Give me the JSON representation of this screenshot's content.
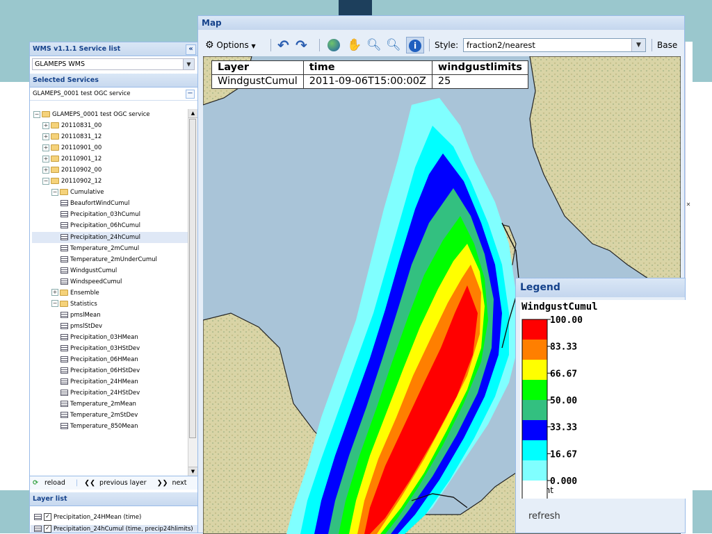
{
  "left_panel": {
    "wms_header": "WMS v1.1.1 Service list",
    "wms_combo_value": "GLAMEPS WMS",
    "selected_header": "Selected Services",
    "service_title": "GLAMEPS_0001 test OGC service",
    "tree": [
      {
        "label": "GLAMEPS_0001 test OGC service",
        "type": "folder",
        "level": 0,
        "expanded": true
      },
      {
        "label": "20110831_00",
        "type": "folder",
        "level": 1,
        "expanded": false
      },
      {
        "label": "20110831_12",
        "type": "folder",
        "level": 1,
        "expanded": false
      },
      {
        "label": "20110901_00",
        "type": "folder",
        "level": 1,
        "expanded": false
      },
      {
        "label": "20110901_12",
        "type": "folder",
        "level": 1,
        "expanded": false
      },
      {
        "label": "20110902_00",
        "type": "folder",
        "level": 1,
        "expanded": false
      },
      {
        "label": "20110902_12",
        "type": "folder",
        "level": 1,
        "expanded": true
      },
      {
        "label": "Cumulative",
        "type": "folder",
        "level": 2,
        "expanded": true
      },
      {
        "label": "BeaufortWindCumul",
        "type": "layer",
        "level": 3
      },
      {
        "label": "Precipitation_03hCumul",
        "type": "layer",
        "level": 3
      },
      {
        "label": "Precipitation_06hCumul",
        "type": "layer",
        "level": 3
      },
      {
        "label": "Precipitation_24hCumul",
        "type": "layer",
        "level": 3,
        "selected": true
      },
      {
        "label": "Temperature_2mCumul",
        "type": "layer",
        "level": 3
      },
      {
        "label": "Temperature_2mUnderCumul",
        "type": "layer",
        "level": 3
      },
      {
        "label": "WindgustCumul",
        "type": "layer",
        "level": 3
      },
      {
        "label": "WindspeedCumul",
        "type": "layer",
        "level": 3
      },
      {
        "label": "Ensemble",
        "type": "folder",
        "level": 2,
        "expanded": false
      },
      {
        "label": "Statistics",
        "type": "folder",
        "level": 2,
        "expanded": true
      },
      {
        "label": "pmslMean",
        "type": "layer",
        "level": 3
      },
      {
        "label": "pmslStDev",
        "type": "layer",
        "level": 3
      },
      {
        "label": "Precipitation_03HMean",
        "type": "layer",
        "level": 3
      },
      {
        "label": "Precipitation_03HStDev",
        "type": "layer",
        "level": 3
      },
      {
        "label": "Precipitation_06HMean",
        "type": "layer",
        "level": 3
      },
      {
        "label": "Precipitation_06HStDev",
        "type": "layer",
        "level": 3
      },
      {
        "label": "Precipitation_24HMean",
        "type": "layer",
        "level": 3
      },
      {
        "label": "Precipitation_24HStDev",
        "type": "layer",
        "level": 3
      },
      {
        "label": "Temperature_2mMean",
        "type": "layer",
        "level": 3
      },
      {
        "label": "Temperature_2mStDev",
        "type": "layer",
        "level": 3
      },
      {
        "label": "Temperature_850Mean",
        "type": "layer",
        "level": 3
      }
    ],
    "toolbar": {
      "reload": "reload",
      "previous": "previous layer",
      "next": "next layer"
    },
    "layer_list_header": "Layer list",
    "layer_list": [
      {
        "label": "Precipitation_24HMean (time)",
        "checked": true
      },
      {
        "label": "Precipitation_24hCumul (time, precip24hlimits)",
        "checked": true
      }
    ]
  },
  "map": {
    "title": "Map",
    "options_label": "Options",
    "style_label": "Style:",
    "style_value": "fraction2/nearest",
    "base_label": "Base",
    "info_table": {
      "headers": [
        "Layer",
        "time",
        "windgustlimits"
      ],
      "values": [
        "WindgustCumul",
        "2011-09-06T15:00:00Z",
        "25"
      ]
    }
  },
  "legend": {
    "title": "Legend",
    "layer_name": "WindgustCumul",
    "ticks": [
      "100.00",
      "83.33",
      "66.67",
      "50.00",
      "33.33",
      "16.67",
      "0.000"
    ],
    "colors": [
      "#ff0000",
      "#ff7f00",
      "#ffff00",
      "#00ff00",
      "#33c080",
      "#0000ff",
      "#00ffff",
      "#80ffff",
      "#ffffff"
    ],
    "unit": "percent",
    "refresh_label": "refresh"
  }
}
